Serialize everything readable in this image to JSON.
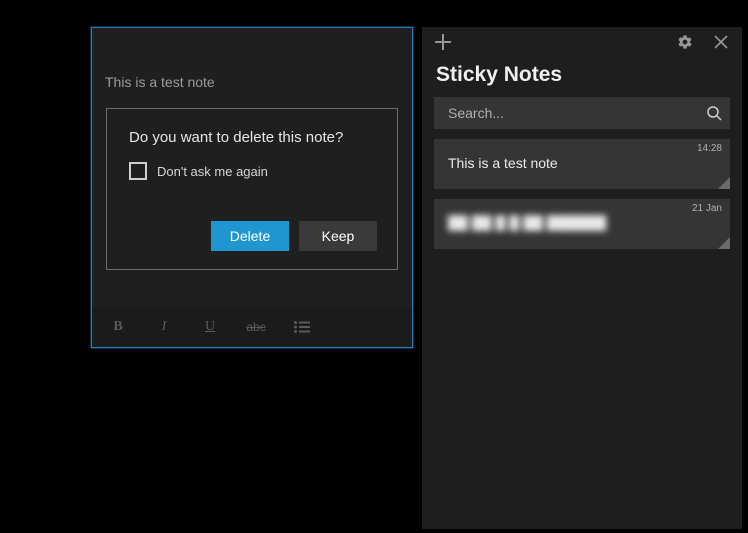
{
  "note": {
    "content": "This is a test note"
  },
  "dialog": {
    "title": "Do you want to delete this note?",
    "dont_ask_label": "Don't ask me again",
    "delete_label": "Delete",
    "keep_label": "Keep"
  },
  "formatting": {
    "bold": "B",
    "italic": "I",
    "underline": "U",
    "strike": "abc"
  },
  "panel": {
    "title": "Sticky Notes",
    "search_placeholder": "Search...",
    "items": [
      {
        "preview": "This is a test note",
        "timestamp": "14:28"
      },
      {
        "preview": "██ ██ █ █ ██  ██████",
        "timestamp": "21 Jan",
        "blurred": true
      }
    ]
  }
}
